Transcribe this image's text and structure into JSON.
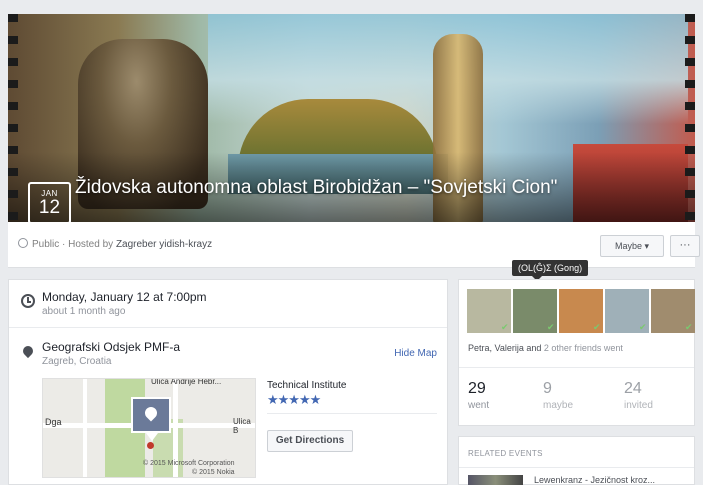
{
  "event": {
    "month": "JAN",
    "day": "12",
    "title": "Židovska autonomna oblast Birobidžan – \"Sovjetski Cion\""
  },
  "host_bar": {
    "privacy": "Public · Hosted by ",
    "host": "Zagreber yidish-krayz",
    "maybe_button": "Maybe ▾",
    "more_button": "···"
  },
  "details": {
    "time_main": "Monday, January 12 at 7:00pm",
    "time_sub": "about 1 month ago",
    "location_main": "Geografski Odsjek PMF-a",
    "location_sub": "Zagreb, Croatia",
    "hide_map": "Hide Map",
    "map_labels": {
      "street_top": "Ulica Andrije Hebr...",
      "street_left": "Dga",
      "street_right": "Ulica B",
      "copyright": "© 2015 Microsoft Corporation\n© 2015 Nokia"
    },
    "place_name": "Technical Institute",
    "rating_stars": "★★★★★",
    "get_directions": "Get Directions"
  },
  "friends": {
    "tooltip": "(ΟL(Ĝ)Σ (Gong)",
    "avatars": [
      {
        "color": "#b8b8a0",
        "checked": true
      },
      {
        "color": "#7a8b6a",
        "checked": true
      },
      {
        "color": "#c8894e",
        "checked": true
      },
      {
        "color": "#9fb0b8",
        "checked": true
      },
      {
        "color": "#a08c6e",
        "checked": true
      }
    ],
    "line_names": "Petra, Valerija",
    "line_and": " and ",
    "line_others": "2 other friends went",
    "stats": [
      {
        "count": "29",
        "label": "went"
      },
      {
        "count": "9",
        "label": "maybe"
      },
      {
        "count": "24",
        "label": "invited"
      }
    ]
  },
  "related": {
    "title": "RELATED EVENTS",
    "first_name": "Lewenkranz - Jezičnost kroz..."
  }
}
